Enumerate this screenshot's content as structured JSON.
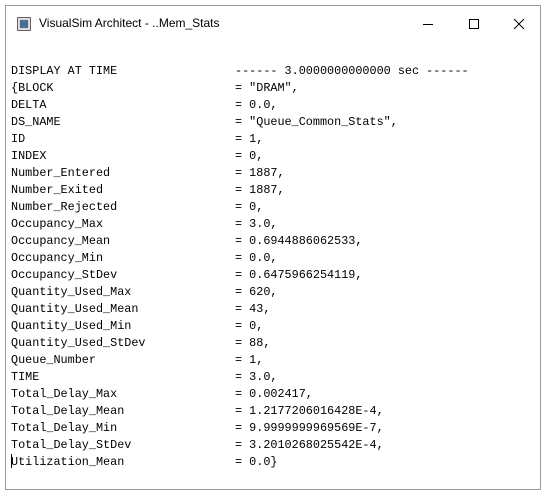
{
  "window": {
    "title": "VisualSim Architect - ..Mem_Stats"
  },
  "lines": [
    {
      "key": "DISPLAY AT TIME",
      "value": "------ 3.0000000000000 sec ------"
    },
    {
      "key": "{BLOCK",
      "value": "= \"DRAM\","
    },
    {
      "key": "DELTA",
      "value": "= 0.0,"
    },
    {
      "key": "DS_NAME",
      "value": "= \"Queue_Common_Stats\","
    },
    {
      "key": "ID",
      "value": "= 1,"
    },
    {
      "key": "INDEX",
      "value": "= 0,"
    },
    {
      "key": "Number_Entered",
      "value": "= 1887,"
    },
    {
      "key": "Number_Exited",
      "value": "= 1887,"
    },
    {
      "key": "Number_Rejected",
      "value": "= 0,"
    },
    {
      "key": "Occupancy_Max",
      "value": "= 3.0,"
    },
    {
      "key": "Occupancy_Mean",
      "value": "= 0.6944886062533,"
    },
    {
      "key": "Occupancy_Min",
      "value": "= 0.0,"
    },
    {
      "key": "Occupancy_StDev",
      "value": "= 0.6475966254119,"
    },
    {
      "key": "Quantity_Used_Max",
      "value": "= 620,"
    },
    {
      "key": "Quantity_Used_Mean",
      "value": "= 43,"
    },
    {
      "key": "Quantity_Used_Min",
      "value": "= 0,"
    },
    {
      "key": "Quantity_Used_StDev",
      "value": "= 88,"
    },
    {
      "key": "Queue_Number",
      "value": "= 1,"
    },
    {
      "key": "TIME",
      "value": "= 3.0,"
    },
    {
      "key": "Total_Delay_Max",
      "value": "= 0.002417,"
    },
    {
      "key": "Total_Delay_Mean",
      "value": "= 1.2177206016428E-4,"
    },
    {
      "key": "Total_Delay_Min",
      "value": "= 9.9999999969569E-7,"
    },
    {
      "key": "Total_Delay_StDev",
      "value": "= 3.2010268025542E-4,"
    },
    {
      "key": "Utilization_Mean",
      "value": "= 0.0}"
    }
  ]
}
